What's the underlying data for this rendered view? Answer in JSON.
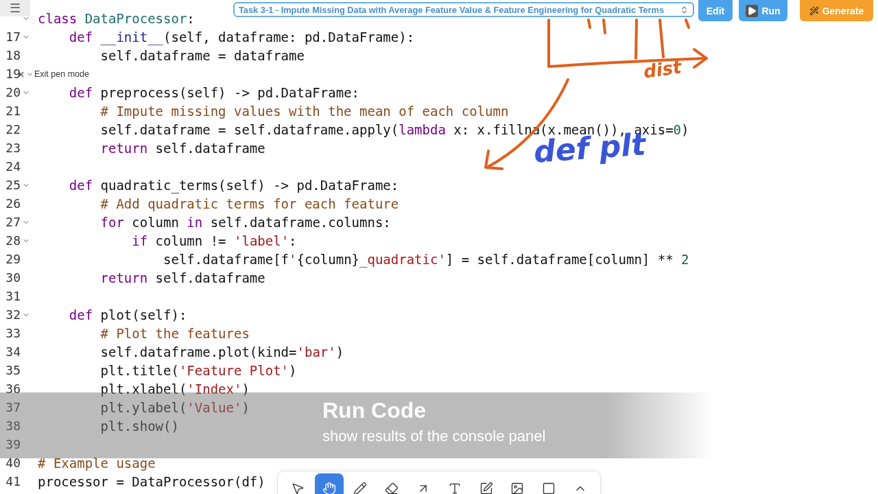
{
  "header": {
    "menu_glyph": "☰",
    "task": "Task 3-1 - Impute Missing Data with Average Feature Value & Feature Engineering for Quadratic Terms",
    "buttons": [
      {
        "kind": "edit",
        "label": "Edit"
      },
      {
        "kind": "run",
        "label": "Run"
      },
      {
        "kind": "generate",
        "label": "Generate"
      }
    ]
  },
  "pen_mode": {
    "label": "Exit pen mode"
  },
  "code_lines": [
    {
      "foldable": true,
      "tokens": [
        {
          "kind": "kw",
          "text": "class"
        },
        {
          "kind": "cls",
          "text": " DataProcessor"
        },
        {
          "kind": "plain",
          "text": ":"
        }
      ]
    },
    {
      "number": "17",
      "foldable": true,
      "tokens": [
        {
          "kind": "kw",
          "text": "    def"
        },
        {
          "kind": "fn",
          "text": " __init__"
        },
        {
          "kind": "plain",
          "text": "(self, dataframe: pd.DataFrame):"
        }
      ]
    },
    {
      "number": "18",
      "foldable": false,
      "tokens": [
        {
          "kind": "plain",
          "text": "        self.dataframe = dataframe"
        }
      ]
    },
    {
      "number": "19",
      "foldable": false
    },
    {
      "number": "20",
      "foldable": true,
      "tokens": [
        {
          "kind": "kw",
          "text": "    def"
        },
        {
          "kind": "plain",
          "text": " preprocess(self) -> pd.DataFrame:"
        }
      ]
    },
    {
      "number": "21",
      "foldable": false,
      "tokens": [
        {
          "kind": "cmt",
          "text": "        # Impute missing values with the mean of each column"
        }
      ]
    },
    {
      "number": "22",
      "foldable": false,
      "tokens": [
        {
          "kind": "plain",
          "text": "        self.dataframe = self.dataframe.apply("
        },
        {
          "kind": "kw",
          "text": "lambda"
        },
        {
          "kind": "plain",
          "text": " x: x.fillna(x.mean()), axis="
        },
        {
          "kind": "num",
          "text": "0"
        },
        {
          "kind": "plain",
          "text": ")"
        }
      ]
    },
    {
      "number": "23",
      "foldable": false,
      "tokens": [
        {
          "kind": "kw",
          "text": "        return"
        },
        {
          "kind": "plain",
          "text": " self.dataframe"
        }
      ]
    },
    {
      "number": "24",
      "foldable": false
    },
    {
      "number": "25",
      "foldable": true,
      "tokens": [
        {
          "kind": "kw",
          "text": "    def"
        },
        {
          "kind": "plain",
          "text": " quadratic_terms(self) -> pd.DataFrame:"
        }
      ]
    },
    {
      "number": "26",
      "foldable": false,
      "tokens": [
        {
          "kind": "cmt",
          "text": "        # Add quadratic terms for each feature"
        }
      ]
    },
    {
      "number": "27",
      "foldable": true,
      "tokens": [
        {
          "kind": "kw",
          "text": "        for"
        },
        {
          "kind": "plain",
          "text": " column "
        },
        {
          "kind": "kw",
          "text": "in"
        },
        {
          "kind": "plain",
          "text": " self.dataframe.columns:"
        }
      ]
    },
    {
      "number": "28",
      "foldable": true,
      "tokens": [
        {
          "kind": "kw",
          "text": "            if"
        },
        {
          "kind": "plain",
          "text": " column != "
        },
        {
          "kind": "str",
          "text": "'label'"
        },
        {
          "kind": "plain",
          "text": ":"
        }
      ]
    },
    {
      "number": "29",
      "foldable": false,
      "tokens": [
        {
          "kind": "plain",
          "text": "                self.dataframe[f"
        },
        {
          "kind": "str",
          "text": "'"
        },
        {
          "kind": "plain",
          "text": "{column}"
        },
        {
          "kind": "str",
          "text": "_quadratic'"
        },
        {
          "kind": "plain",
          "text": "] = self.dataframe[column] ** "
        },
        {
          "kind": "num",
          "text": "2"
        }
      ]
    },
    {
      "number": "30",
      "foldable": false,
      "tokens": [
        {
          "kind": "kw",
          "text": "        return"
        },
        {
          "kind": "plain",
          "text": " self.dataframe"
        }
      ]
    },
    {
      "number": "31",
      "foldable": false
    },
    {
      "number": "32",
      "foldable": true,
      "tokens": [
        {
          "kind": "kw",
          "text": "    def"
        },
        {
          "kind": "plain",
          "text": " plot(self):"
        }
      ]
    },
    {
      "number": "33",
      "foldable": false,
      "tokens": [
        {
          "kind": "cmt",
          "text": "        # Plot the features"
        }
      ]
    },
    {
      "number": "34",
      "foldable": false,
      "tokens": [
        {
          "kind": "plain",
          "text": "        self.dataframe.plot(kind="
        },
        {
          "kind": "str",
          "text": "'bar'"
        },
        {
          "kind": "plain",
          "text": ")"
        }
      ]
    },
    {
      "number": "35",
      "foldable": false,
      "tokens": [
        {
          "kind": "plain",
          "text": "        plt.title("
        },
        {
          "kind": "str",
          "text": "'Feature Plot'"
        },
        {
          "kind": "plain",
          "text": ")"
        }
      ]
    },
    {
      "number": "36",
      "foldable": false,
      "tokens": [
        {
          "kind": "plain",
          "text": "        plt.xlabel("
        },
        {
          "kind": "str",
          "text": "'Index'"
        },
        {
          "kind": "plain",
          "text": ")"
        }
      ]
    },
    {
      "number": "37",
      "foldable": false,
      "tokens": [
        {
          "kind": "plain",
          "text": "        plt.ylabel("
        },
        {
          "kind": "str",
          "text": "'Value'"
        },
        {
          "kind": "plain",
          "text": ")"
        }
      ]
    },
    {
      "number": "38",
      "foldable": false,
      "tokens": [
        {
          "kind": "plain",
          "text": "        plt.show()"
        }
      ]
    },
    {
      "number": "39",
      "foldable": false
    },
    {
      "number": "40",
      "foldable": false,
      "tokens": [
        {
          "kind": "cmt",
          "text": "# Example usage"
        }
      ]
    },
    {
      "number": "41",
      "foldable": false,
      "tokens": [
        {
          "kind": "plain",
          "text": "processor = DataProcessor(df)"
        }
      ]
    }
  ],
  "ink": [
    {
      "kind": "orange",
      "text": "dist"
    },
    {
      "kind": "blue",
      "text": "def plt"
    }
  ],
  "caption": {
    "title": "Run Code",
    "subtitle": "show results of the console panel"
  },
  "tools": [
    {
      "kind": "pointer",
      "selected": false
    },
    {
      "kind": "hand",
      "selected": true
    },
    {
      "kind": "pencil",
      "selected": false
    },
    {
      "kind": "eraser",
      "selected": false
    },
    {
      "kind": "arrow",
      "selected": false
    },
    {
      "kind": "text",
      "selected": false
    },
    {
      "kind": "note",
      "selected": false
    },
    {
      "kind": "image",
      "selected": false
    },
    {
      "kind": "rectangle",
      "selected": false
    },
    {
      "kind": "collapse",
      "selected": false
    }
  ]
}
